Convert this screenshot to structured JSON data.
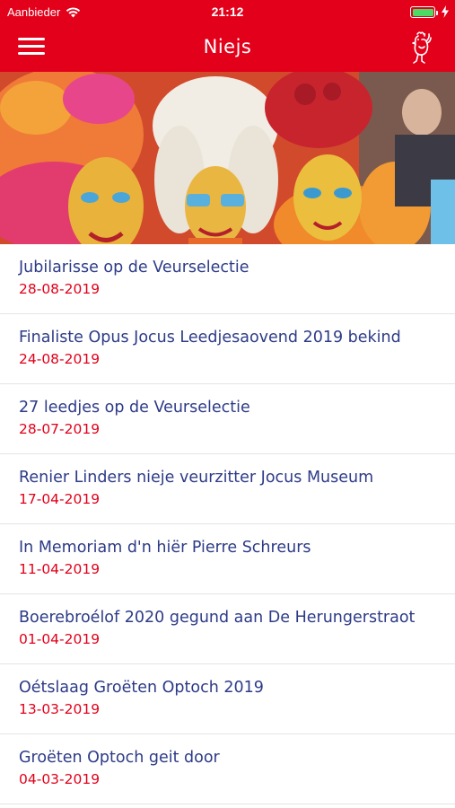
{
  "status_bar": {
    "carrier": "Aanbieder",
    "time": "21:12",
    "battery_level": 1.0,
    "charging": true
  },
  "nav": {
    "title": "Niejs",
    "menu_icon": "hamburger-icon",
    "logo_icon": "rooster-logo-icon"
  },
  "hero": {
    "description_icon": "carnival-photo"
  },
  "news": [
    {
      "title": "Jubilarisse op de Veurselectie",
      "date": "28-08-2019"
    },
    {
      "title": "Finaliste Opus Jocus Leedjesaovend 2019 bekind",
      "date": "24-08-2019"
    },
    {
      "title": "27 leedjes op de Veurselectie",
      "date": "28-07-2019"
    },
    {
      "title": "Renier Linders nieje veurzitter Jocus Museum",
      "date": "17-04-2019"
    },
    {
      "title": "In Memoriam d'n hiër Pierre Schreurs",
      "date": "11-04-2019"
    },
    {
      "title": "Boerebroélof 2020 gegund aan De Herungerstraot",
      "date": "01-04-2019"
    },
    {
      "title": "Oétslaag Groëten Optoch 2019",
      "date": "13-03-2019"
    },
    {
      "title": "Groëten Optoch geit door",
      "date": "04-03-2019"
    }
  ],
  "colors": {
    "accent": "#e2001a",
    "title_text": "#2d3b87",
    "date_text": "#e2001a"
  }
}
